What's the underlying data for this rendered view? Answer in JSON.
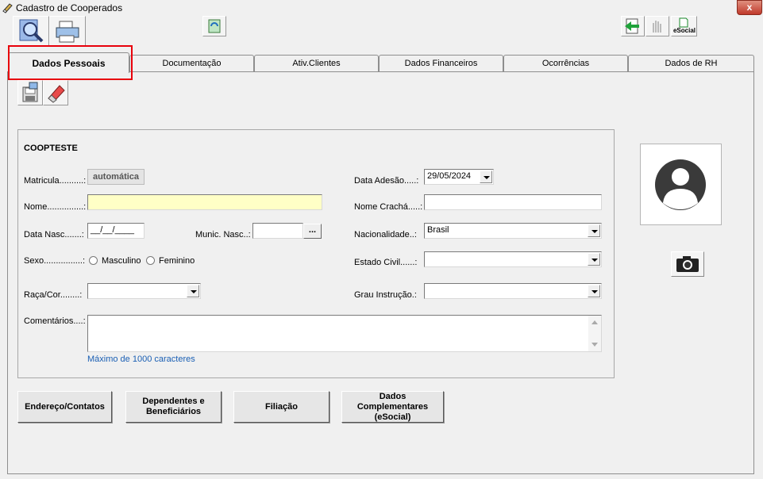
{
  "window": {
    "title": "Cadastro de Cooperados",
    "close_label": "x"
  },
  "tabs": [
    {
      "label": "Dados Pessoais",
      "underline": "P",
      "active": true
    },
    {
      "label": "Documentação",
      "underline": "D"
    },
    {
      "label": "Ativ.Clientes",
      "underline": "A"
    },
    {
      "label": "Dados Financeiros",
      "underline": "F"
    },
    {
      "label": "Ocorrências",
      "underline": "O"
    },
    {
      "label": "Dados de RH",
      "underline": "R"
    }
  ],
  "toolbar": {
    "esocial_label": "eSocial"
  },
  "form": {
    "group_title": "COOPTESTE",
    "matricula": {
      "label": "Matricula..........:",
      "value": "automática"
    },
    "nome": {
      "label": "Nome...............:",
      "value": ""
    },
    "data_nasc": {
      "label": "Data Nasc.......:",
      "value": "__/__/____"
    },
    "munic_nasc": {
      "label": "Munic. Nasc..:",
      "value": "",
      "button": "..."
    },
    "sexo": {
      "label": "Sexo................:",
      "options": [
        "Masculino",
        "Feminino"
      ]
    },
    "raca_cor": {
      "label": "Raça/Cor........:",
      "value": ""
    },
    "comentarios": {
      "label": "Comentários....:",
      "value": "",
      "hint": "Máximo de 1000 caracteres"
    },
    "data_adesao": {
      "label": "Data Adesão.....:",
      "value": "29/05/2024"
    },
    "nome_cracha": {
      "label": "Nome Crachá.....:",
      "value": ""
    },
    "nacionalidade": {
      "label": "Nacionalidade..:",
      "value": "Brasil"
    },
    "estado_civil": {
      "label": "Estado Civil......:",
      "value": ""
    },
    "grau_instrucao": {
      "label": "Grau Instrução.:",
      "value": ""
    }
  },
  "buttons": {
    "endereco": "Endereço/Contatos",
    "dependentes": [
      "Dependentes e",
      "Beneficiários"
    ],
    "filiacao": "Filiação",
    "dados_complementares": [
      "Dados",
      "Complementares",
      "(eSocial)"
    ]
  },
  "colors": {
    "highlight": "#e8000b",
    "hint_text": "#1a5fb4",
    "required_field": "#ffffc6"
  }
}
